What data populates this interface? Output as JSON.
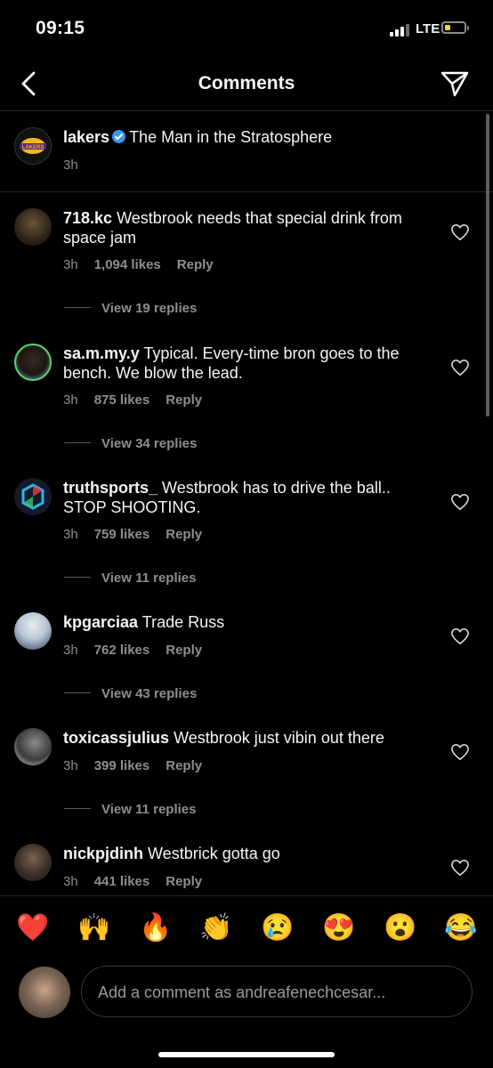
{
  "status": {
    "time": "09:15",
    "network": "LTE"
  },
  "nav": {
    "title": "Comments"
  },
  "caption": {
    "username": "lakers",
    "text": "The Man in the Stratosphere",
    "time": "3h",
    "avatar_text": "LAKERS"
  },
  "comments": [
    {
      "username": "718.kc",
      "text": "Westbrook needs that special drink from space jam",
      "time": "3h",
      "likes": "1,094 likes",
      "reply": "Reply",
      "view_replies": "View 19 replies"
    },
    {
      "username": "sa.m.my.y",
      "text": "Typical. Every-time bron goes to the bench. We blow the lead.",
      "time": "3h",
      "likes": "875 likes",
      "reply": "Reply",
      "view_replies": "View 34 replies"
    },
    {
      "username": "truthsports_",
      "text": "Westbrook has to drive the ball.. STOP SHOOTING.",
      "time": "3h",
      "likes": "759 likes",
      "reply": "Reply",
      "view_replies": "View 11 replies"
    },
    {
      "username": "kpgarciaa",
      "text": "Trade Russ",
      "time": "3h",
      "likes": "762 likes",
      "reply": "Reply",
      "view_replies": "View 43 replies"
    },
    {
      "username": "toxicassjulius",
      "text": "Westbrook just vibin out there",
      "time": "3h",
      "likes": "399 likes",
      "reply": "Reply",
      "view_replies": "View 11 replies"
    },
    {
      "username": "nickpjdinh",
      "text": "Westbrick gotta go",
      "time": "3h",
      "likes": "441 likes",
      "reply": "Reply"
    }
  ],
  "emoji_bar": [
    "❤️",
    "🙌",
    "🔥",
    "👏",
    "😢",
    "😍",
    "😮",
    "😂"
  ],
  "composer": {
    "placeholder": "Add a comment as andreafenechcesar..."
  },
  "colors": {
    "background": "#000000",
    "text": "#f5f5f5",
    "secondary": "#8e8e8e",
    "verified": "#3897f0",
    "battery": "#f7d31f"
  }
}
